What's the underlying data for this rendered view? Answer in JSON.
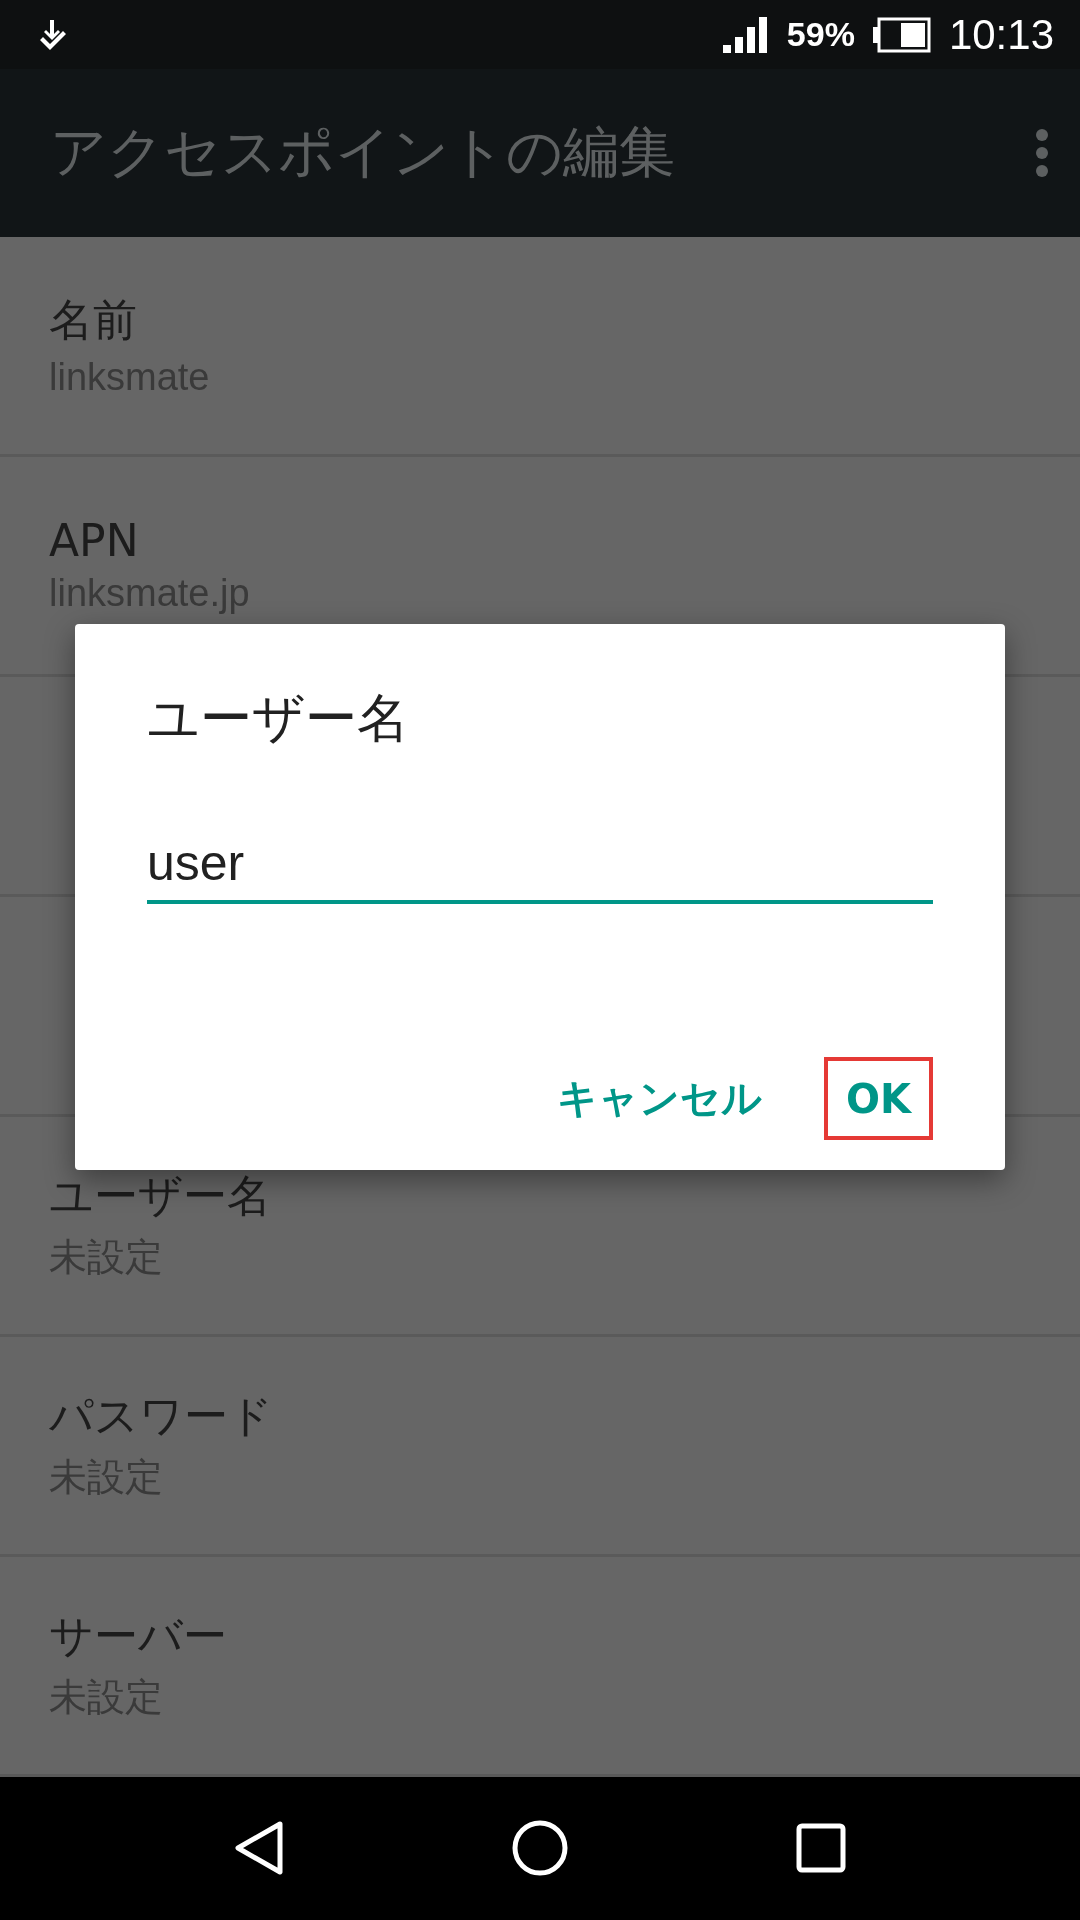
{
  "status_bar": {
    "battery": "59%",
    "time": "10:13"
  },
  "app_bar": {
    "title": "アクセスポイントの編集"
  },
  "settings": [
    {
      "label": "名前",
      "value": "linksmate"
    },
    {
      "label": "APN",
      "value": "linksmate.jp"
    },
    {
      "kind": "covered"
    },
    {
      "kind": "covered"
    },
    {
      "label": "ユーザー名",
      "value": "未設定"
    },
    {
      "label": "パスワード",
      "value": "未設定"
    },
    {
      "label": "サーバー",
      "value": "未設定"
    }
  ],
  "dialog": {
    "title": "ユーザー名",
    "value": "user",
    "buttons": [
      {
        "label": "キャンセル",
        "highlighted": false
      },
      {
        "label": "OK",
        "highlighted": true
      }
    ]
  }
}
